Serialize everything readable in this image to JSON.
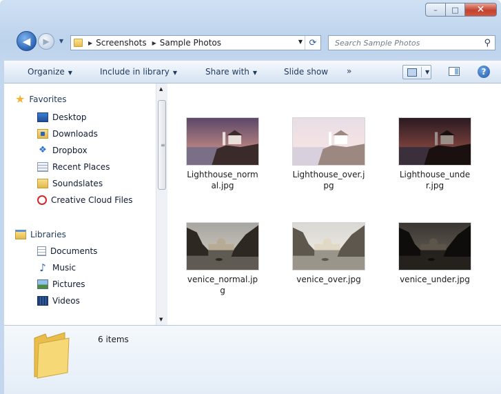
{
  "window": {
    "caption_buttons": {
      "minimize": "–",
      "maximize": "□",
      "close": "✕"
    }
  },
  "address_bar": {
    "crumbs": [
      "Screenshots",
      "Sample Photos"
    ],
    "refresh_glyph": "⟳"
  },
  "search": {
    "placeholder": "Search Sample Photos"
  },
  "toolbar": {
    "organize": "Organize",
    "include": "Include in library",
    "share": "Share with",
    "slideshow": "Slide show",
    "more": "»",
    "help": "?"
  },
  "nav": {
    "favorites": {
      "label": "Favorites",
      "items": [
        "Desktop",
        "Downloads",
        "Dropbox",
        "Recent Places",
        "Soundslates",
        "Creative Cloud Files"
      ]
    },
    "libraries": {
      "label": "Libraries",
      "items": [
        "Documents",
        "Music",
        "Pictures",
        "Videos"
      ]
    }
  },
  "files": [
    {
      "name": "Lighthouse_norm\nal.jpg",
      "kind": "lighthouse",
      "tone": "normal"
    },
    {
      "name": "Lighthouse_over.j\npg",
      "kind": "lighthouse",
      "tone": "over"
    },
    {
      "name": "Lighthouse_unde\nr.jpg",
      "kind": "lighthouse",
      "tone": "under"
    },
    {
      "name": "venice_normal.jp\ng",
      "kind": "venice",
      "tone": "normal"
    },
    {
      "name": "venice_over.jpg",
      "kind": "venice",
      "tone": "over"
    },
    {
      "name": "venice_under.jpg",
      "kind": "venice",
      "tone": "under"
    }
  ],
  "details": {
    "count": "6 items"
  },
  "colors": {
    "accent": "#1e395b",
    "frame": "#c3d7ee",
    "close": "#c2422f",
    "folder": "#f0c955"
  }
}
